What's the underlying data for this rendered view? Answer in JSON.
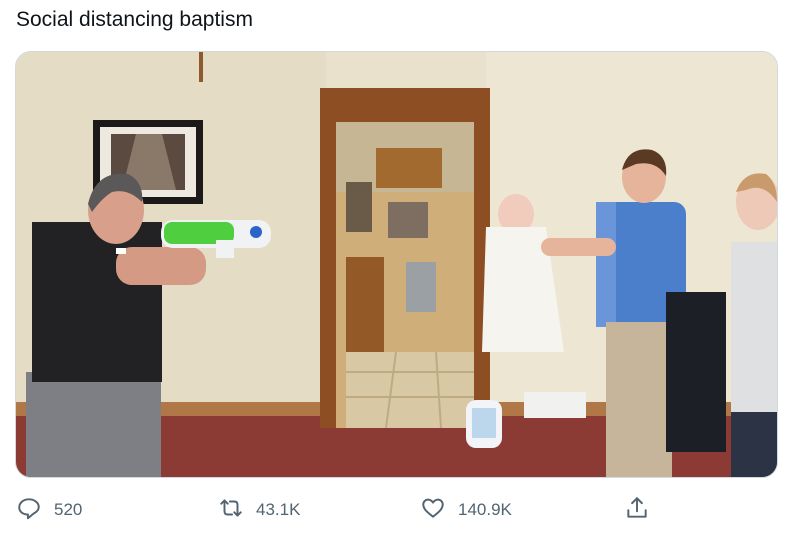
{
  "tweet": {
    "text": "Social distancing baptism"
  },
  "media": {
    "alt": ""
  },
  "actions": {
    "reply": {
      "icon": "reply-icon",
      "count": "520"
    },
    "retweet": {
      "icon": "retweet-icon",
      "count": "43.1K"
    },
    "like": {
      "icon": "heart-icon",
      "count": "140.9K"
    },
    "share": {
      "icon": "share-icon"
    }
  },
  "colors": {
    "text": "#0f1419",
    "secondary": "#536471",
    "border": "#cfd9de"
  }
}
